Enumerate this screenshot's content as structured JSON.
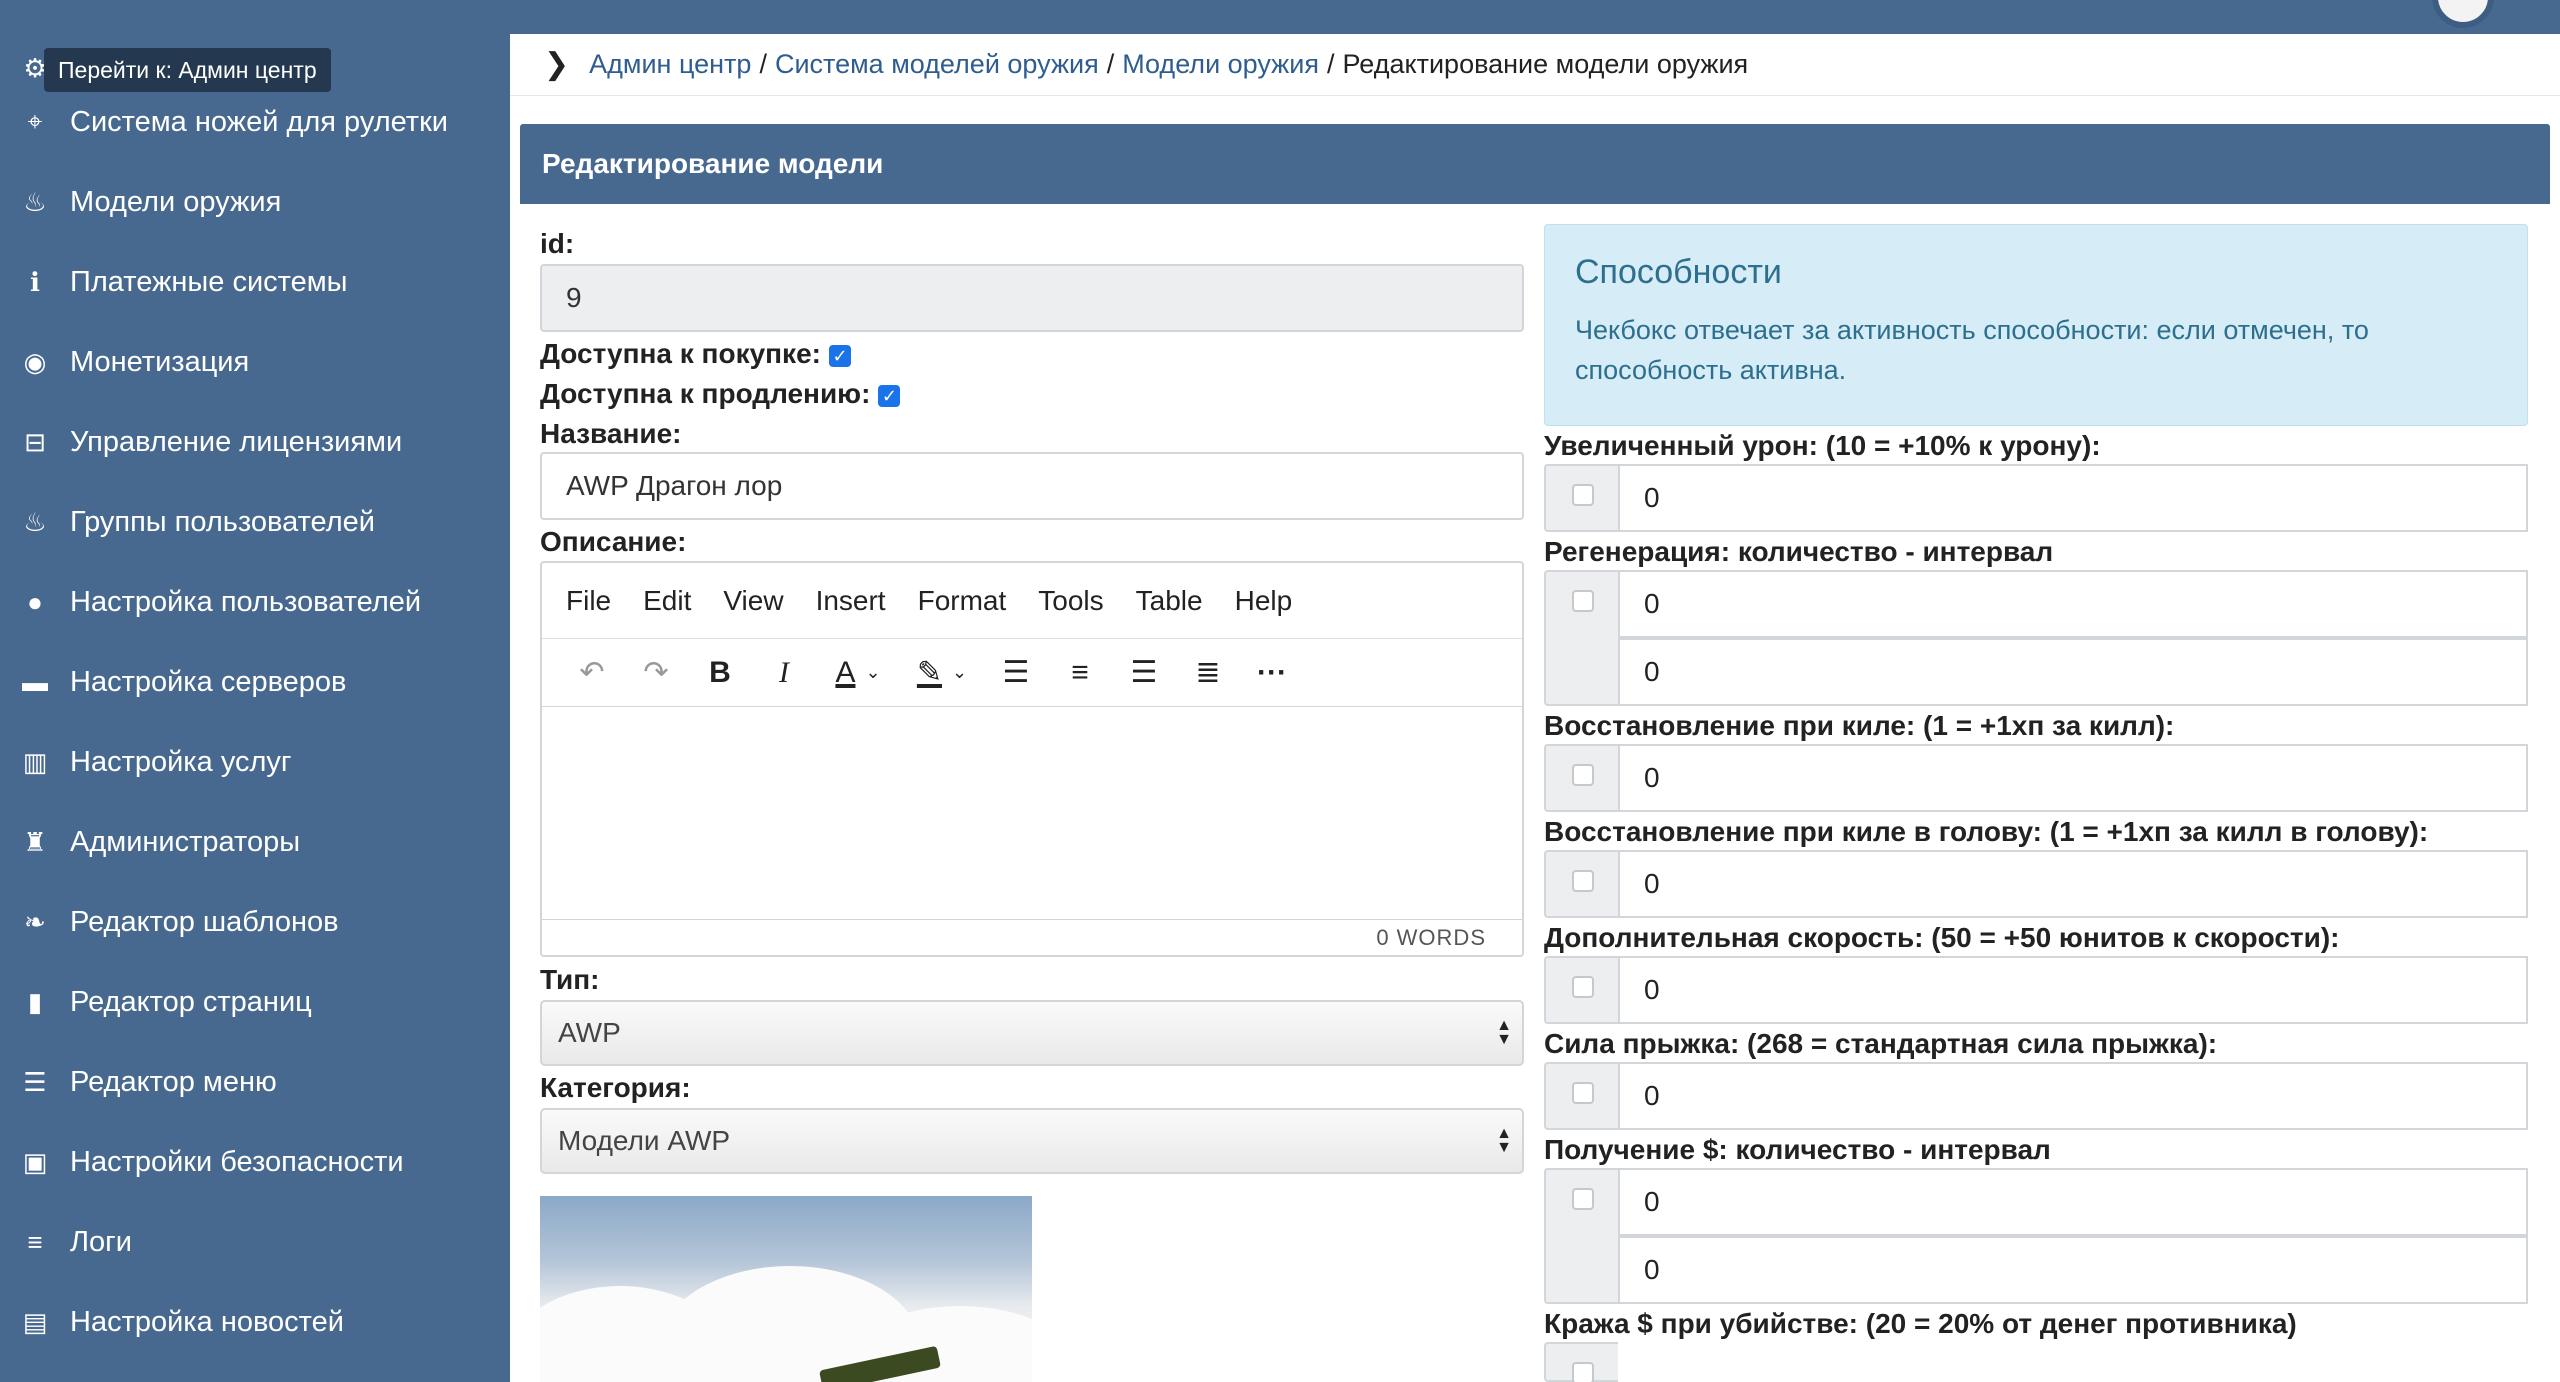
{
  "tooltip": "Перейти к: Админ центр",
  "sidebar": {
    "items": [
      {
        "label": "Система ножей для рулетки",
        "icon": "crosshair-icon",
        "glyph": "⌖"
      },
      {
        "label": "Модели оружия",
        "icon": "fire-icon",
        "glyph": "♨"
      },
      {
        "label": "Платежные системы",
        "icon": "info-icon",
        "glyph": "ℹ"
      },
      {
        "label": "Монетизация",
        "icon": "piggy-bank-icon",
        "glyph": "◉"
      },
      {
        "label": "Управление лицензиями",
        "icon": "inbox-icon",
        "glyph": "⊟"
      },
      {
        "label": "Группы пользователей",
        "icon": "fire-icon",
        "glyph": "♨"
      },
      {
        "label": "Настройка пользователей",
        "icon": "user-icon",
        "glyph": "●"
      },
      {
        "label": "Настройка серверов",
        "icon": "server-icon",
        "glyph": "▬"
      },
      {
        "label": "Настройка услуг",
        "icon": "barcode-icon",
        "glyph": "▥"
      },
      {
        "label": "Администраторы",
        "icon": "chess-icon",
        "glyph": "♜"
      },
      {
        "label": "Редактор шаблонов",
        "icon": "leaf-icon",
        "glyph": "❧"
      },
      {
        "label": "Редактор страниц",
        "icon": "file-icon",
        "glyph": "▮"
      },
      {
        "label": "Редактор меню",
        "icon": "list-icon",
        "glyph": "☰"
      },
      {
        "label": "Настройки безопасности",
        "icon": "lock-icon",
        "glyph": "▣"
      },
      {
        "label": "Логи",
        "icon": "bars-icon",
        "glyph": "≡"
      },
      {
        "label": "Настройка новостей",
        "icon": "newspaper-icon",
        "glyph": "▤"
      }
    ]
  },
  "breadcrumb": {
    "items": [
      "Админ центр",
      "Система моделей оружия",
      "Модели оружия"
    ],
    "separator": "/",
    "current": "Редактирование модели оружия"
  },
  "panel": {
    "title": "Редактирование модели"
  },
  "form": {
    "id_label": "id:",
    "id_value": "9",
    "buy_label": "Доступна к покупке:",
    "buy_checked": true,
    "renew_label": "Доступна к продлению:",
    "renew_checked": true,
    "name_label": "Название:",
    "name_value": "AWP Драгон лор",
    "desc_label": "Описание:",
    "editor_menu": [
      "File",
      "Edit",
      "View",
      "Insert",
      "Format",
      "Tools",
      "Table",
      "Help"
    ],
    "editor_words": "0 WORDS",
    "type_label": "Тип:",
    "type_value": "AWP",
    "category_label": "Категория:",
    "category_value": "Модели AWP"
  },
  "abilities": {
    "title": "Способности",
    "description": "Чекбокс отвечает за активность способности: если отмечен, то способность активна.",
    "items": [
      {
        "label": "Увеличенный урон: (10 = +10% к урону):",
        "values": [
          "0"
        ]
      },
      {
        "label": "Регенерация: количество - интервал",
        "values": [
          "0",
          "0"
        ]
      },
      {
        "label": "Восстановление при киле: (1 = +1хп за килл):",
        "values": [
          "0"
        ]
      },
      {
        "label": "Восстановление при киле в голову: (1 = +1хп за килл в голову):",
        "values": [
          "0"
        ]
      },
      {
        "label": "Дополнительная скорость: (50 = +50 юнитов к скорости):",
        "values": [
          "0"
        ]
      },
      {
        "label": "Сила прыжка: (268 = стандартная сила прыжка):",
        "values": [
          "0"
        ]
      },
      {
        "label": "Получение $: количество - интервал",
        "values": [
          "0",
          "0"
        ]
      },
      {
        "label": "Кража $ при убийстве: (20 = 20% от денег противника)",
        "values": []
      }
    ]
  },
  "colors": {
    "brand": "#48698f",
    "link": "#2f5d8f",
    "info_bg": "#d6ecf6"
  }
}
